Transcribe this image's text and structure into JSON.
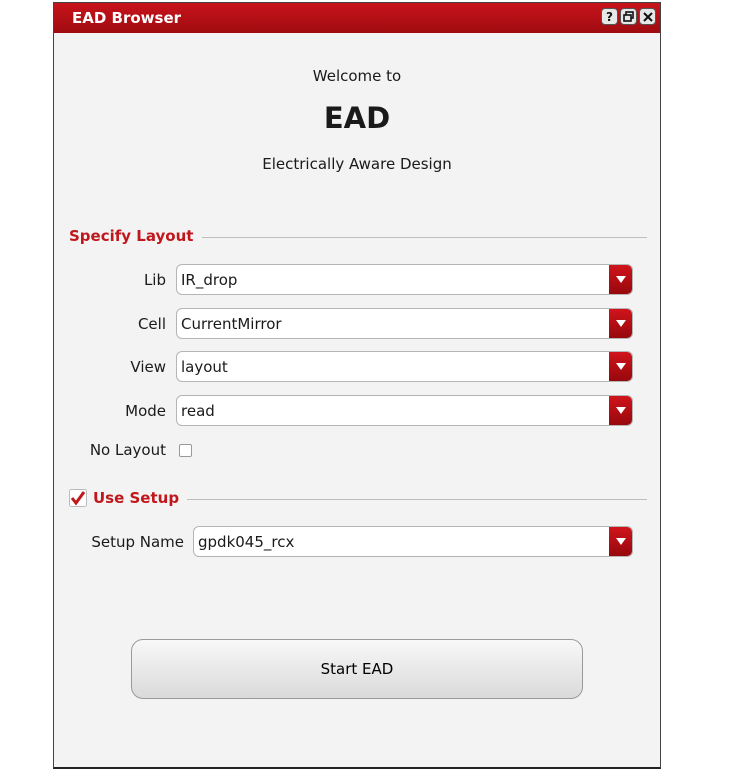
{
  "window": {
    "title": "EAD Browser",
    "titlebar_icons": [
      "help-icon",
      "restore-icon",
      "close-icon"
    ],
    "accent_color": "#c0171c"
  },
  "header": {
    "welcome": "Welcome to",
    "app_name": "EAD",
    "subtitle": "Electrically Aware Design"
  },
  "layout_section": {
    "title": "Specify Layout",
    "fields": [
      {
        "label": "Lib",
        "value": "IR_drop"
      },
      {
        "label": "Cell",
        "value": "CurrentMirror"
      },
      {
        "label": "View",
        "value": "layout"
      },
      {
        "label": "Mode",
        "value": "read"
      }
    ],
    "no_layout": {
      "label": "No Layout",
      "checked": false
    }
  },
  "setup_section": {
    "title": "Use Setup",
    "checked": true,
    "setup_name_label": "Setup Name",
    "setup_name_value": "gpdk045_rcx"
  },
  "actions": {
    "start_label": "Start EAD"
  }
}
